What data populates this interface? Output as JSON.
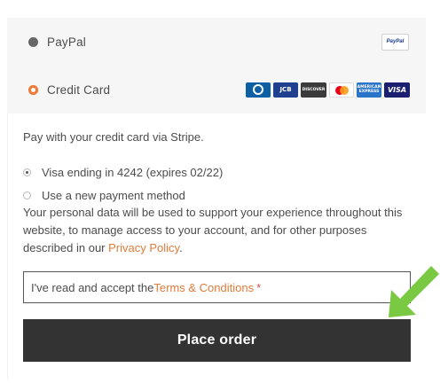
{
  "payment_methods": [
    {
      "label": "PayPal",
      "selected": false,
      "badge": "PayPal"
    },
    {
      "label": "Credit Card",
      "selected": true
    }
  ],
  "card_brands": {
    "jcb": "JCB",
    "discover": "DISCOVER",
    "amex": "AMERICAN EXPRESS",
    "visa": "VISA"
  },
  "stripe": {
    "description": "Pay with your credit card via Stripe.",
    "saved_card": "Visa ending in 4242 (expires 02/22)",
    "new_method": "Use a new payment method"
  },
  "privacy": {
    "text": "Your personal data will be used to support your experience throughout this website, to manage access to your account, and for other purposes described in our ",
    "link": "Privacy Policy",
    "end": "."
  },
  "terms": {
    "prefix": "I've read and accept the ",
    "link": "Terms & Conditions",
    "required_mark": "*"
  },
  "place_order_label": "Place order",
  "colors": {
    "accent": "#e07b39",
    "button_bg": "#333333",
    "arrow": "#7ac943"
  }
}
